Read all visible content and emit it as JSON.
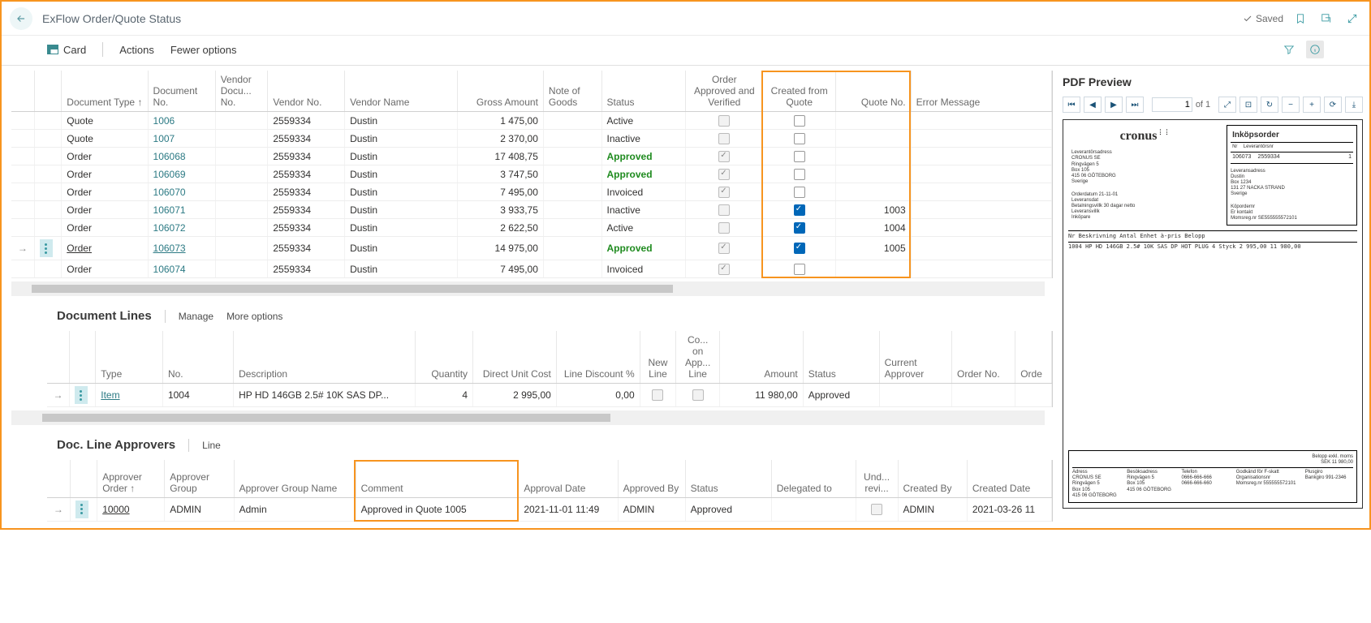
{
  "header": {
    "title": "ExFlow Order/Quote Status",
    "saved_label": "Saved"
  },
  "cmdbar": {
    "card": "Card",
    "actions": "Actions",
    "fewer": "Fewer options"
  },
  "table": {
    "columns": {
      "doc_type": "Document Type ↑",
      "doc_no": "Document No.",
      "vendor_docu_no": "Vendor Docu... No.",
      "vendor_no": "Vendor No.",
      "vendor_name": "Vendor Name",
      "gross_amount": "Gross Amount",
      "note_goods": "Note of Goods",
      "status": "Status",
      "order_approved_verified": "Order Approved and Verified",
      "created_from_quote": "Created from Quote",
      "quote_no": "Quote No.",
      "error_message": "Error Message"
    },
    "rows": [
      {
        "sel": "",
        "doc_type": "Quote",
        "doc_no": "1006",
        "vendor_no": "2559334",
        "vendor_name": "Dustin",
        "gross": "1 475,00",
        "status": "Active",
        "oav": false,
        "oav_dis": true,
        "cfq": false,
        "quote_no": ""
      },
      {
        "sel": "",
        "doc_type": "Quote",
        "doc_no": "1007",
        "vendor_no": "2559334",
        "vendor_name": "Dustin",
        "gross": "2 370,00",
        "status": "Inactive",
        "oav": false,
        "oav_dis": true,
        "cfq": false,
        "quote_no": ""
      },
      {
        "sel": "",
        "doc_type": "Order",
        "doc_no": "106068",
        "vendor_no": "2559334",
        "vendor_name": "Dustin",
        "gross": "17 408,75",
        "status": "Approved",
        "status_strong": true,
        "oav": true,
        "oav_dis": true,
        "cfq": false,
        "quote_no": ""
      },
      {
        "sel": "",
        "doc_type": "Order",
        "doc_no": "106069",
        "vendor_no": "2559334",
        "vendor_name": "Dustin",
        "gross": "3 747,50",
        "status": "Approved",
        "status_strong": true,
        "oav": true,
        "oav_dis": true,
        "cfq": false,
        "quote_no": ""
      },
      {
        "sel": "",
        "doc_type": "Order",
        "doc_no": "106070",
        "vendor_no": "2559334",
        "vendor_name": "Dustin",
        "gross": "7 495,00",
        "status": "Invoiced",
        "oav": true,
        "oav_dis": true,
        "cfq": false,
        "quote_no": ""
      },
      {
        "sel": "",
        "doc_type": "Order",
        "doc_no": "106071",
        "vendor_no": "2559334",
        "vendor_name": "Dustin",
        "gross": "3 933,75",
        "status": "Inactive",
        "oav": false,
        "oav_dis": true,
        "cfq": true,
        "quote_no": "1003"
      },
      {
        "sel": "",
        "doc_type": "Order",
        "doc_no": "106072",
        "vendor_no": "2559334",
        "vendor_name": "Dustin",
        "gross": "2 622,50",
        "status": "Active",
        "oav": false,
        "oav_dis": true,
        "cfq": true,
        "quote_no": "1004"
      },
      {
        "sel": "→",
        "doc_type": "Order",
        "doc_no": "106073",
        "vendor_no": "2559334",
        "vendor_name": "Dustin",
        "gross": "14 975,00",
        "status": "Approved",
        "status_strong": true,
        "oav": true,
        "oav_dis": true,
        "cfq": true,
        "quote_no": "1005",
        "menu": true,
        "underline": true
      },
      {
        "sel": "",
        "doc_type": "Order",
        "doc_no": "106074",
        "vendor_no": "2559334",
        "vendor_name": "Dustin",
        "gross": "7 495,00",
        "status": "Invoiced",
        "oav": true,
        "oav_dis": true,
        "cfq": false,
        "quote_no": ""
      }
    ]
  },
  "doclines": {
    "title": "Document Lines",
    "manage": "Manage",
    "more": "More options",
    "columns": {
      "type": "Type",
      "no": "No.",
      "description": "Description",
      "quantity": "Quantity",
      "duc": "Direct Unit Cost",
      "disc": "Line Discount %",
      "newline": "New Line",
      "coapp": "Co... on App... Line",
      "amount": "Amount",
      "status": "Status",
      "curr_appr": "Current Approver",
      "order_no": "Order No.",
      "ordel": "Orde"
    },
    "row": {
      "sel": "→",
      "type": "Item",
      "no": "1004",
      "description": "HP HD 146GB 2.5# 10K SAS DP...",
      "quantity": "4",
      "duc": "2 995,00",
      "disc": "0,00",
      "newline": false,
      "coapp": false,
      "amount": "11 980,00",
      "status": "Approved"
    }
  },
  "approvers": {
    "title": "Doc. Line Approvers",
    "line_label": "Line",
    "columns": {
      "order": "Approver Order ↑",
      "group": "Approver Group",
      "group_name": "Approver Group Name",
      "comment": "Comment",
      "approval_date": "Approval Date",
      "approved_by": "Approved By",
      "status": "Status",
      "delegated": "Delegated to",
      "und": "Und... revi...",
      "created_by": "Created By",
      "created_date": "Created Date"
    },
    "row": {
      "sel": "→",
      "order": "10000",
      "group": "ADMIN",
      "group_name": "Admin",
      "comment": "Approved in Quote 1005",
      "approval_date": "2021-11-01 11:49",
      "approved_by": "ADMIN",
      "status": "Approved",
      "delegated": "",
      "und": false,
      "created_by": "ADMIN",
      "created_date": "2021-03-26 11"
    }
  },
  "pdf": {
    "title": "PDF Preview",
    "page": "1",
    "of": "of 1",
    "doc_title": "Inköpsorder",
    "order_no_lbl": "Nr",
    "order_no": "106073",
    "vendor_no": "2559334",
    "vendor_one": "1",
    "left_name": "CRONUS SE",
    "left_l1": "Ringvägen 5",
    "left_l2": "Box 105",
    "left_l3": "415 06 GÖTEBORG",
    "left_l4": "Sverige",
    "right_name": "Dustin",
    "right_l1": "Box 1234",
    "right_l2": "131 27 NACKA STRAND",
    "right_l3": "Sverige",
    "orderdatum": "Orderdatum   21-11-01",
    "leveransdat": "Leveransdat",
    "betal": "Betalningsvillk 30 dagar netto",
    "levvillk": "Leveransvillk",
    "inkopare": "Inköpare",
    "er_kontakt": "Er kontakt",
    "momsreg": "Momsreg.nr   SE555555572101",
    "line_hdr": "Nr    Beskrivning                                              Antal Enhet   à-pris         Belopp",
    "line_1": "1004  HP HD 146GB 2.5# 10K SAS DP HOT PLUG                          4 Styck  2 995,00     11 980,00",
    "tot1": "Belopp exkl. moms",
    "tot2": "SEK  11 980,00",
    "foot_company": "CRONUS SE",
    "foot_addr": "Ringvägen 5",
    "foot_box": "Box 105",
    "foot_city": "415 06 GÖTEBORG",
    "foot_phone": "0666-666-666",
    "foot_fax": "0666-666-660",
    "foot_org": "Organisationsnr",
    "foot_vat": "Momsreg.nr 555555572101",
    "foot_pg": "Plusgiro",
    "foot_bg": "Bankgiro 991-2346"
  }
}
